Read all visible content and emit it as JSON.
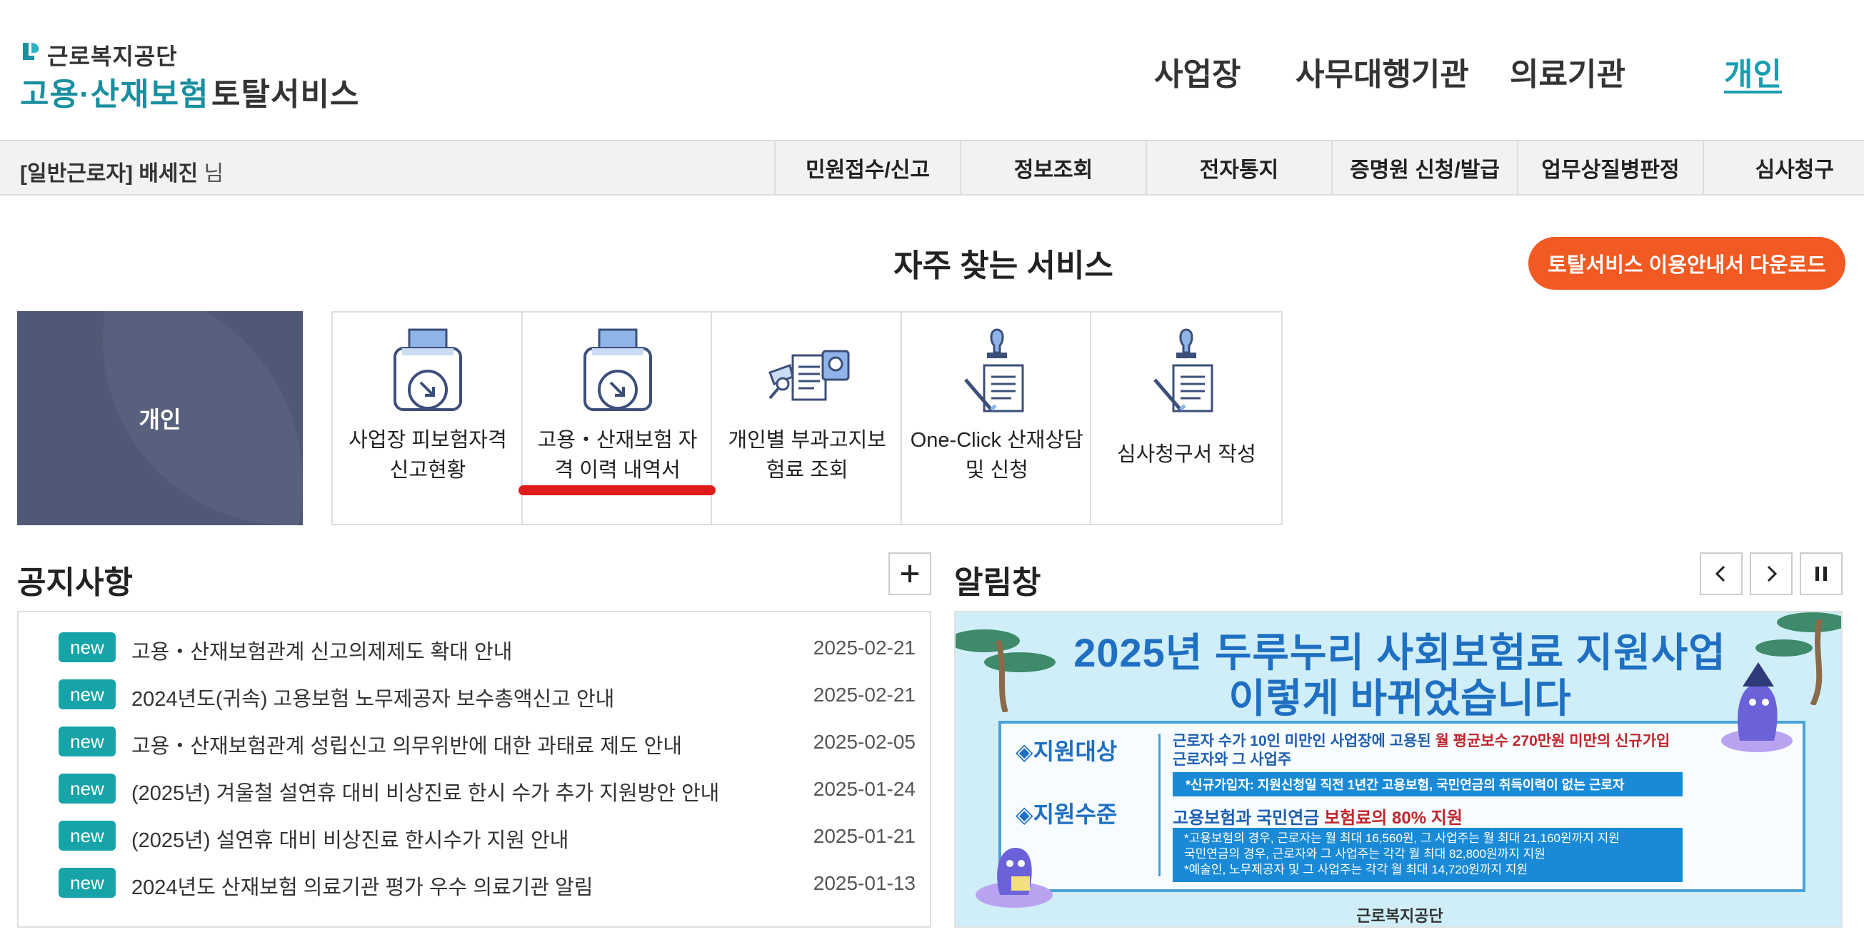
{
  "header": {
    "org_name": "근로복지공단",
    "service_name_part1": "고용·산재보험",
    "service_name_part2": "토탈서비스",
    "nav": [
      "사업장",
      "사무대행기관",
      "의료기관",
      "개인"
    ],
    "active_nav": "개인"
  },
  "subbar": {
    "user_role": "[일반근로자] 배세진",
    "user_suffix": "님",
    "menus": [
      "민원접수/신고",
      "정보조회",
      "전자통지",
      "증명원 신청/발급",
      "업무상질병판정",
      "심사청구"
    ]
  },
  "frequent_services": {
    "title": "자주 찾는 서비스",
    "download_button": "토탈서비스 이용안내서 다운로드",
    "category_card": "개인",
    "items": [
      {
        "label_line1": "사업장 피보험자격",
        "label_line2": "신고현황",
        "icon": "printer-download-icon"
      },
      {
        "label_line1": "고용・산재보험 자",
        "label_line2": "격 이력 내역서",
        "icon": "printer-download-icon"
      },
      {
        "label_line1": "개인별 부과고지보",
        "label_line2": "험료 조회",
        "icon": "document-search-icon"
      },
      {
        "label_line1": "One-Click 산재상담",
        "label_line2": "및 신청",
        "icon": "stamp-document-icon"
      },
      {
        "label_line1": "심사청구서 작성",
        "label_line2": "",
        "icon": "stamp-document-icon"
      }
    ],
    "accent_colors": {
      "highlight_underline": "#e01b1b",
      "card_bg": "#46506e",
      "download_bg": "#f15a22"
    }
  },
  "notices": {
    "title": "공지사항",
    "badge": "new",
    "items": [
      {
        "text": "고용・산재보험관계 신고의제제도 확대 안내",
        "date": "2025-02-21"
      },
      {
        "text": "2024년도(귀속) 고용보험 노무제공자 보수총액신고 안내",
        "date": "2025-02-21"
      },
      {
        "text": "고용・산재보험관계 성립신고 의무위반에 대한 과태료 제도 안내",
        "date": "2025-02-05"
      },
      {
        "text": "(2025년) 겨울철 설연휴 대비 비상진료 한시 수가 추가 지원방안 안내",
        "date": "2025-01-24"
      },
      {
        "text": "(2025년) 설연휴 대비 비상진료 한시수가 지원 안내",
        "date": "2025-01-21"
      },
      {
        "text": "2024년도 산재보험 의료기관 평가 우수 의료기관 알림",
        "date": "2025-01-13"
      }
    ]
  },
  "alerts": {
    "title": "알림창",
    "banner": {
      "headline1": "2025년 두루누리 사회보험료 지원사업",
      "headline2": "이렇게 바뀌었습니다",
      "label_target": "◈지원대상",
      "target_text_a": "근로자 수가 10인 미만인 사업장에 고용된 ",
      "target_text_b": "월 평균보수 270만원 미만의 신규가입",
      "target_text_c": "근로자와 그 사업주",
      "target_note": "*신규가입자: 지원신청일 직전 1년간 고용보험, 국민연금의 취득이력이 없는 근로자",
      "label_level": "◈지원수준",
      "level_text_a": "고용보험과 국민연금 ",
      "level_text_b": "보험료의 80% 지원",
      "level_note1": "*고용보험의 경우, 근로자는 월 최대 16,560원, 그 사업주는 월 최대 21,160원까지 지원",
      "level_note2": "  국민연금의 경우, 근로자와 그 사업주는 각각 월 최대 82,800원까지 지원",
      "level_note3": "*예술인, 노무제공자 및 그 사업주는 각각 월 최대 14,720원까지 지원",
      "footer": "근로복지공단"
    }
  }
}
